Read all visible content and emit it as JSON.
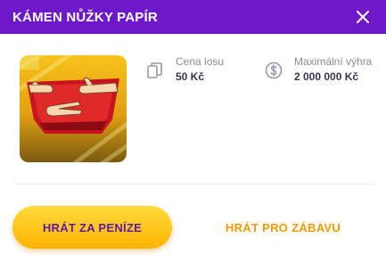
{
  "header": {
    "title": "KÁMEN NŮŽKY PAPÍR",
    "close_icon": "close-icon",
    "background": "#6d18c9"
  },
  "game": {
    "thumbnail_icon": "rock-paper-scissors-hands-image"
  },
  "ticket_price": {
    "icon": "tickets-icon",
    "label": "Cena losu",
    "value": "50 Kč"
  },
  "max_win": {
    "icon": "dollar-coin-icon",
    "label": "Maximální výhra",
    "value": "2 000 000 Kč"
  },
  "actions": {
    "play_money_label": "HRÁT ZA PENÍZE",
    "play_fun_label": "HRÁT PRO ZÁBAVU",
    "primary_color": "#ffc107",
    "secondary_text_color": "#ef9a00"
  }
}
